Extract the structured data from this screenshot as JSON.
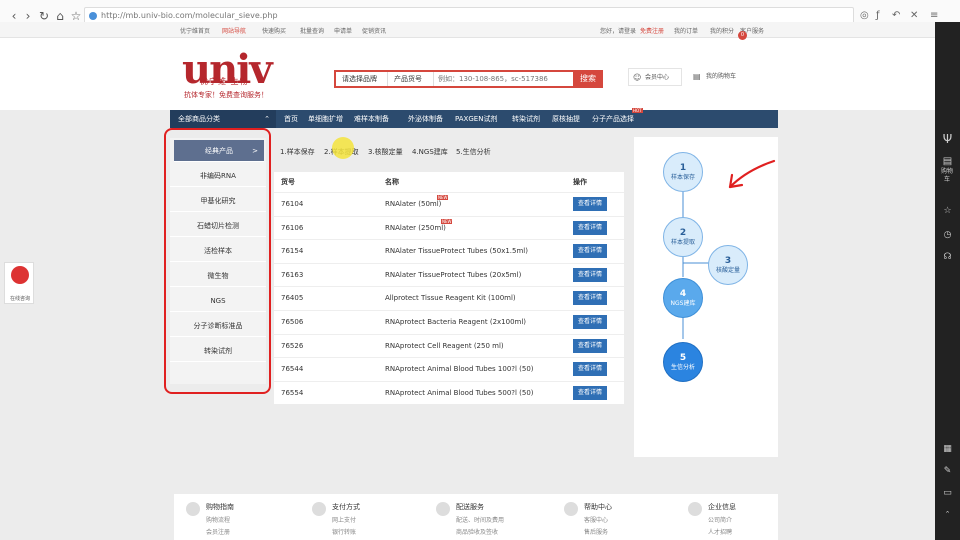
{
  "browser": {
    "url": "http://mb.univ-bio.com/molecular_sieve.php"
  },
  "topbar": {
    "links": [
      "优宁维首页",
      "网站导航",
      "快速购买",
      "批量查询",
      "申请单",
      "促销资讯"
    ],
    "right": [
      "您好，请登录",
      "免费注册",
      "我的订单",
      "我的积分",
      "客户服务"
    ]
  },
  "header": {
    "logo": "univ",
    "logo_sub": "优宁维 生物",
    "tagline": "抗体专家！免费查询服务！",
    "search": {
      "brand_select": "请选择品牌",
      "field_select": "产品货号",
      "placeholder": "例如：130-108-865，sc-517386",
      "button": "搜索"
    },
    "member": "会员中心",
    "cart": "我的购物车",
    "cart_count": "0"
  },
  "nav": {
    "all_label": "全部商品分类",
    "items": [
      "首页",
      "单细胞扩增",
      "难样本制备",
      "外泌体制备",
      "PAXGEN试剂",
      "转染试剂",
      "原核抽提",
      "分子产品选择"
    ],
    "hot": "HOT"
  },
  "categories": [
    "经典产品",
    "非编码RNA",
    "甲基化研究",
    "石蜡切片检测",
    "活检样本",
    "微生物",
    "NGS",
    "分子诊断标准品",
    "转染试剂"
  ],
  "active_arrow": ">",
  "workflow_tabs": [
    "1.样本保存",
    "2.样本提取",
    "3.核酸定量",
    "4.NGS建库",
    "5.生信分析"
  ],
  "table": {
    "headers": [
      "货号",
      "名称",
      "操作"
    ],
    "button_label": "查看详情",
    "rows": [
      {
        "no": "76104",
        "name": "RNAlater (50ml)",
        "new": "NEW"
      },
      {
        "no": "76106",
        "name": "RNAlater (250ml)",
        "new": "NEW"
      },
      {
        "no": "76154",
        "name": "RNAlater TissueProtect Tubes (50x1.5ml)",
        "new": ""
      },
      {
        "no": "76163",
        "name": "RNAlater TissueProtect Tubes (20x5ml)",
        "new": ""
      },
      {
        "no": "76405",
        "name": "Allprotect Tissue Reagent Kit (100ml)",
        "new": ""
      },
      {
        "no": "76506",
        "name": "RNAprotect Bacteria Reagent (2x100ml)",
        "new": ""
      },
      {
        "no": "76526",
        "name": "RNAprotect Cell Reagent (250 ml)",
        "new": ""
      },
      {
        "no": "76544",
        "name": "RNAprotect Animal Blood Tubes 100?l (50)",
        "new": ""
      },
      {
        "no": "76554",
        "name": "RNAprotect Animal Blood Tubes 500?l (50)",
        "new": ""
      }
    ]
  },
  "flow": {
    "nodes": [
      {
        "num": "1",
        "label": "样本保存"
      },
      {
        "num": "2",
        "label": "样本提取"
      },
      {
        "num": "3",
        "label": "核酸定量"
      },
      {
        "num": "4",
        "label": "NGS建库"
      },
      {
        "num": "5",
        "label": "生信分析"
      }
    ]
  },
  "footer": {
    "cols": [
      {
        "title": "购物指南",
        "sub1": "购物流程",
        "sub2": "会员注册"
      },
      {
        "title": "支付方式",
        "sub1": "网上支付",
        "sub2": "银行转账"
      },
      {
        "title": "配送服务",
        "sub1": "配送、时间及费用",
        "sub2": "商品验收及签收"
      },
      {
        "title": "帮助中心",
        "sub1": "客服中心",
        "sub2": "售后服务"
      },
      {
        "title": "企业信息",
        "sub1": "公司简介",
        "sub2": "人才招聘"
      }
    ]
  },
  "chat": {
    "label": "在线咨询"
  },
  "sidebar_right": {
    "cart_label": "购物车"
  }
}
